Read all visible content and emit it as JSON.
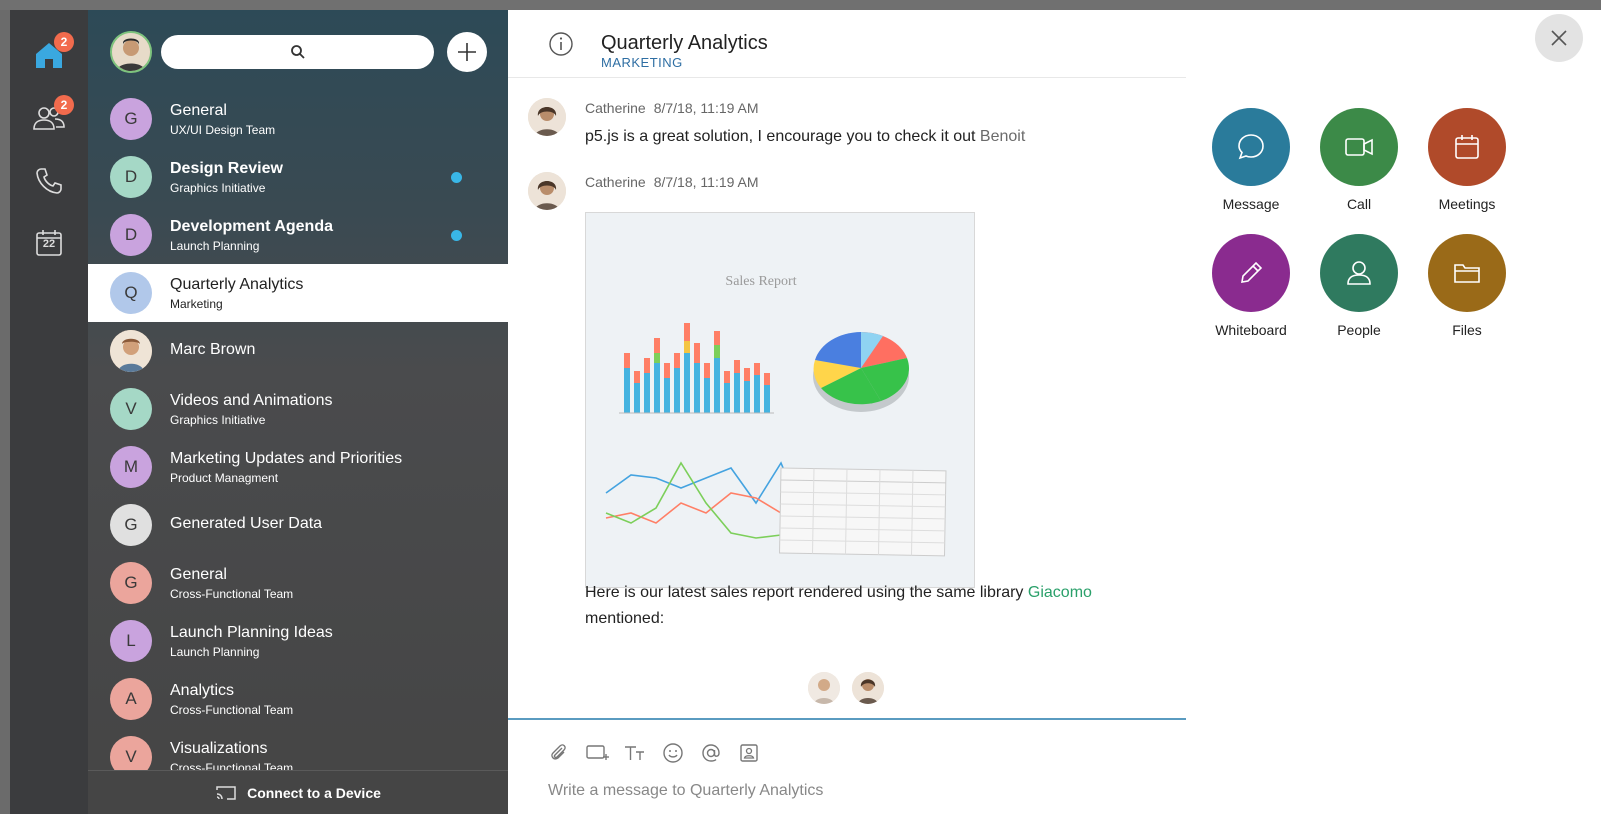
{
  "rail": {
    "home_badge": "2",
    "teams_badge": "2",
    "calendar_day": "22"
  },
  "search": {
    "placeholder": ""
  },
  "spaces": [
    {
      "initial": "G",
      "name": "General",
      "sub": "UX/UI Design Team",
      "color": "#c9a3de",
      "bold": false,
      "unread": false
    },
    {
      "initial": "D",
      "name": "Design Review",
      "sub": "Graphics Initiative",
      "color": "#a5d8c6",
      "bold": true,
      "unread": true
    },
    {
      "initial": "D",
      "name": "Development Agenda",
      "sub": "Launch Planning",
      "color": "#c9a3de",
      "bold": true,
      "unread": true
    },
    {
      "initial": "Q",
      "name": "Quarterly Analytics",
      "sub": "Marketing",
      "color": "#b1c8ea",
      "bold": false,
      "unread": false,
      "active": true
    },
    {
      "initial": "",
      "name": "Marc Brown",
      "sub": "",
      "color": "#d9b28f",
      "bold": false,
      "unread": false,
      "photo": true
    },
    {
      "initial": "V",
      "name": "Videos and Animations",
      "sub": "Graphics Initiative",
      "color": "#a5d8c6",
      "bold": false,
      "unread": false
    },
    {
      "initial": "M",
      "name": "Marketing Updates and Priorities",
      "sub": "Product Managment",
      "color": "#c9a3de",
      "bold": false,
      "unread": false
    },
    {
      "initial": "G",
      "name": "Generated User Data",
      "sub": "",
      "color": "#e0e0e0",
      "bold": false,
      "unread": false
    },
    {
      "initial": "G",
      "name": "General",
      "sub": "Cross-Functional Team",
      "color": "#eba59c",
      "bold": false,
      "unread": false
    },
    {
      "initial": "L",
      "name": "Launch Planning Ideas",
      "sub": "Launch Planning",
      "color": "#c9a3de",
      "bold": false,
      "unread": false
    },
    {
      "initial": "A",
      "name": "Analytics",
      "sub": "Cross-Functional Team",
      "color": "#eba59c",
      "bold": false,
      "unread": false
    },
    {
      "initial": "V",
      "name": "Visualizations",
      "sub": "Cross-Functional Team",
      "color": "#eba59c",
      "bold": false,
      "unread": false
    }
  ],
  "connect": {
    "label": "Connect to a Device"
  },
  "chat": {
    "title": "Quarterly Analytics",
    "subtitle": "MARKETING",
    "messages": [
      {
        "author": "Catherine",
        "time": "8/7/18, 11:19 AM",
        "text": "p5.js is a great solution, I encourage you to check it out",
        "mention": "Benoit"
      },
      {
        "author": "Catherine",
        "time": "8/7/18, 11:19 AM",
        "text": "Here is our latest sales report rendered using the same library",
        "mention": "Giacomo",
        "text_after": "mentioned:"
      }
    ],
    "image_title": "Sales Report",
    "composer_placeholder": "Write a message to Quarterly Analytics"
  },
  "actions": [
    {
      "label": "Message",
      "color": "#2a7b9b",
      "icon": "message-icon"
    },
    {
      "label": "Call",
      "color": "#3c8a48",
      "icon": "video-call-icon"
    },
    {
      "label": "Meetings",
      "color": "#b04a2a",
      "icon": "calendar-icon"
    },
    {
      "label": "Whiteboard",
      "color": "#8a2b8f",
      "icon": "pencil-icon"
    },
    {
      "label": "People",
      "color": "#2f7a5f",
      "icon": "person-icon"
    },
    {
      "label": "Files",
      "color": "#9a6a18",
      "icon": "folder-icon"
    }
  ]
}
